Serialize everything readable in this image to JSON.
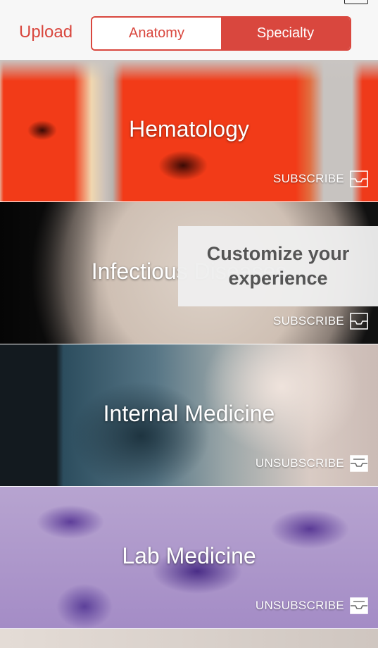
{
  "nav": {
    "upload_label": "Upload",
    "segments": [
      {
        "label": "Anatomy",
        "active": false
      },
      {
        "label": "Specialty",
        "active": true
      }
    ]
  },
  "cards": [
    {
      "title": "Hematology",
      "action": "SUBSCRIBE",
      "icon": "tray-empty-icon"
    },
    {
      "title": "Infectious Diseases",
      "action": "SUBSCRIBE",
      "icon": "tray-empty-icon"
    },
    {
      "title": "Internal Medicine",
      "action": "UNSUBSCRIBE",
      "icon": "tray-full-icon"
    },
    {
      "title": "Lab Medicine",
      "action": "UNSUBSCRIBE",
      "icon": "tray-full-icon"
    }
  ],
  "tooltip": {
    "text": "Customize your experience"
  },
  "colors": {
    "accent": "#d9473e",
    "background": "#f7f7f7",
    "tooltip_bg": "#eeeeee",
    "tooltip_text": "#555555"
  }
}
